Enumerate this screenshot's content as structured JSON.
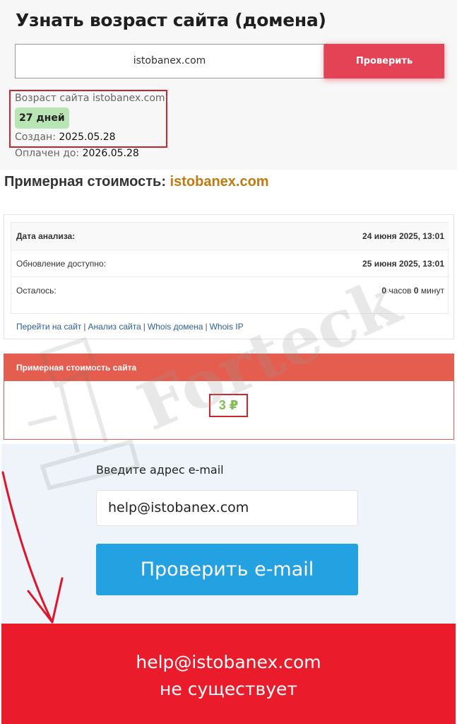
{
  "age_checker": {
    "title": "Узнать возраст сайта (домена)",
    "domain_value": "istobanex.com",
    "check_button": "Проверить",
    "age_label": "Возраст сайта istobanex.com:",
    "age_value": "27 дней",
    "created_label": "Создан:",
    "created_value": "2025.05.28",
    "paid_label": "Оплачен до:",
    "paid_value": "2026.05.28"
  },
  "estimate": {
    "title_prefix": "Примерная стоимость:",
    "title_domain": "istobanex.com",
    "rows": [
      {
        "label": "Дата анализа:",
        "value": "24 июня 2025, 13:01"
      },
      {
        "label": "Обновление доступно:",
        "value": "25 июня 2025, 13:01"
      }
    ],
    "remaining": {
      "label": "Осталось:",
      "hours": "0",
      "hours_unit": "часов",
      "minutes": "0",
      "minutes_unit": "минут"
    },
    "links": [
      "Перейти на сайт",
      "Анализ сайта",
      "Whois домена",
      "Whois IP"
    ],
    "price_header": "Примерная стоимость сайта",
    "price_value": "3 ₽"
  },
  "email_checker": {
    "label": "Введите адрес e-mail",
    "email_value": "help@istobanex.com",
    "check_button": "Проверить e-mail",
    "result_line1": "help@istobanex.com",
    "result_line2": "не существует"
  },
  "watermark": "Forteck",
  "colors": {
    "check_button": "#e44356",
    "highlight_box": "#c9262e",
    "age_badge": "#b9e4b3",
    "domain_accent": "#c2790f",
    "price_header": "#e45d4e",
    "price_value": "#7dbe53",
    "email_button": "#23a1e1",
    "result_banner": "#ea1c2c"
  }
}
